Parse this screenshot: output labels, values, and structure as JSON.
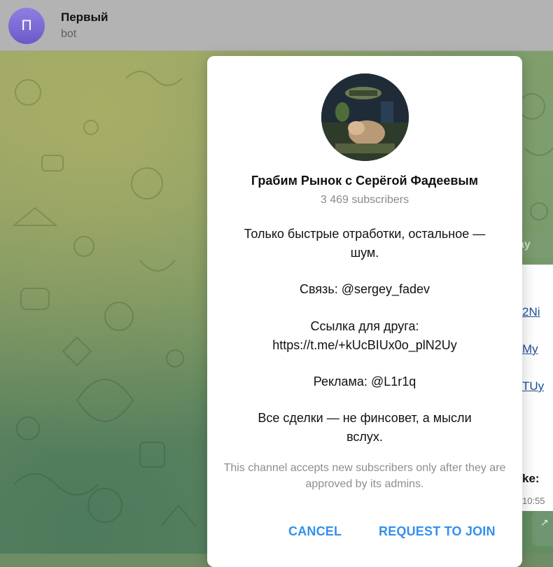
{
  "header": {
    "avatar_letter": "П",
    "title": "Первый",
    "subtitle": "bot"
  },
  "background": {
    "chip": "ay",
    "link1": "2Ni",
    "link2": "My",
    "link3": "TUy",
    "bold_text": "ke:",
    "time": "10:55"
  },
  "dialog": {
    "title": "Грабим Рынок с Серёгой Фадеевым",
    "subscribers": "3 469 subscribers",
    "description": [
      "Только быстрые отработки, остальное —\nшум.",
      "Связь: @sergey_fadev",
      "Ссылка для друга:\nhttps://t.me/+kUcBIUx0o_plN2Uy",
      "Реклама: @L1r1q",
      "Все сделки — не финсовет, а мысли\nвслух."
    ],
    "note": "This channel accepts new subscribers only after they are approved by its admins.",
    "cancel_label": "CANCEL",
    "join_label": "REQUEST TO JOIN"
  },
  "colors": {
    "accent": "#3390ec",
    "header_bg": "#b3b3b3",
    "avatar_bg": "#7a68d6"
  },
  "icons": {
    "share": "share-arrow-icon"
  }
}
